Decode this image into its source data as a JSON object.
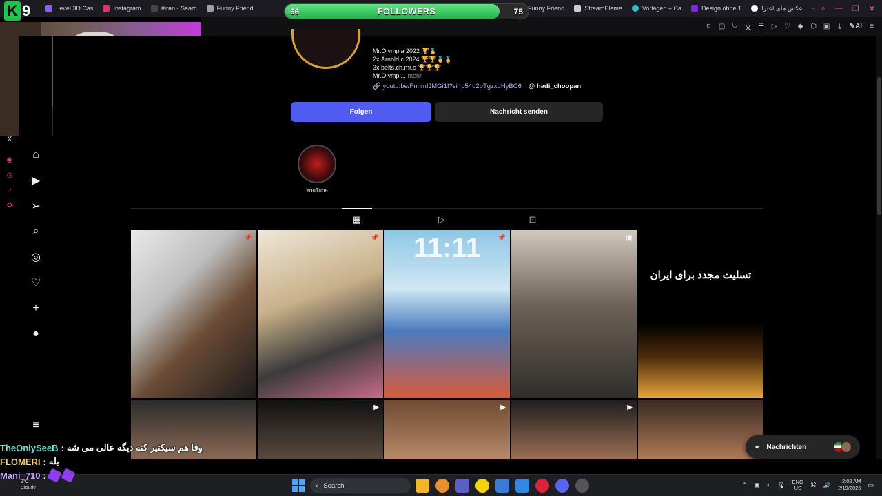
{
  "browser": {
    "tabs": [
      {
        "label": "Level 3D Cas",
        "color": "#8b5cf6"
      },
      {
        "label": "Instagram",
        "color": "#e1306c"
      },
      {
        "label": "#iran - Searc",
        "color": "#cccccc"
      },
      {
        "label": "Funny Friend",
        "color": "#9aa0a6"
      },
      {
        "label": "Funny Friend",
        "color": "#9aa0a6"
      },
      {
        "label": "StreamEleme",
        "color": "#cccccc"
      },
      {
        "label": "Vorlagen – Ca",
        "color": "#20c4cb"
      },
      {
        "label": "Design ohne T",
        "color": "#7d2ae8"
      },
      {
        "label": "عکس های اعترا",
        "color": "#4285f4"
      }
    ],
    "new_tab": "+",
    "ai_label": "AI"
  },
  "overlay": {
    "followers_label": "FOLLOWERS",
    "followers_current": "66",
    "followers_goal": "75",
    "followers_fraction": 0.88,
    "logo_letter": "K",
    "logo_number": "9",
    "social_x": "X"
  },
  "profile": {
    "bio_lines": [
      "Mr.Olympia 2022 🏆🥇",
      "2x.Arnold.c 2024 🏆🏆🥇🥇",
      "3x belts.ch.mr.o 🏆🏆🏆",
      "Mr.Olympi..."
    ],
    "bio_more": "mehr",
    "link_url": "youtu.be/FnnmIJMGi1I?si=p54u2pTgzxuHyBC6",
    "threads_handle": "hadi_choopan",
    "follow_button": "Folgen",
    "message_button": "Nachricht senden",
    "highlight_label": "YouTube"
  },
  "grid": {
    "post5_text": "تسلیت مجدد برای ایران",
    "clock_text": "11:11"
  },
  "chat": [
    {
      "user": "TheOnlySeeB",
      "sep": ":",
      "message": "وفا هم سیکتیر کنه دیگه عالی می شه"
    },
    {
      "user": "FLOMERI",
      "sep": ":",
      "message": "بله"
    },
    {
      "user": "Mani_710",
      "sep": ":",
      "message": ""
    }
  ],
  "messages_pill": {
    "label": "Nachrichten"
  },
  "taskbar": {
    "weather_temp": "3°C",
    "weather_desc": "Cloudy",
    "search_placeholder": "Search",
    "lang_top": "ENG",
    "lang_bottom": "US",
    "time": "2:02 AM",
    "date": "2/19/2026"
  }
}
